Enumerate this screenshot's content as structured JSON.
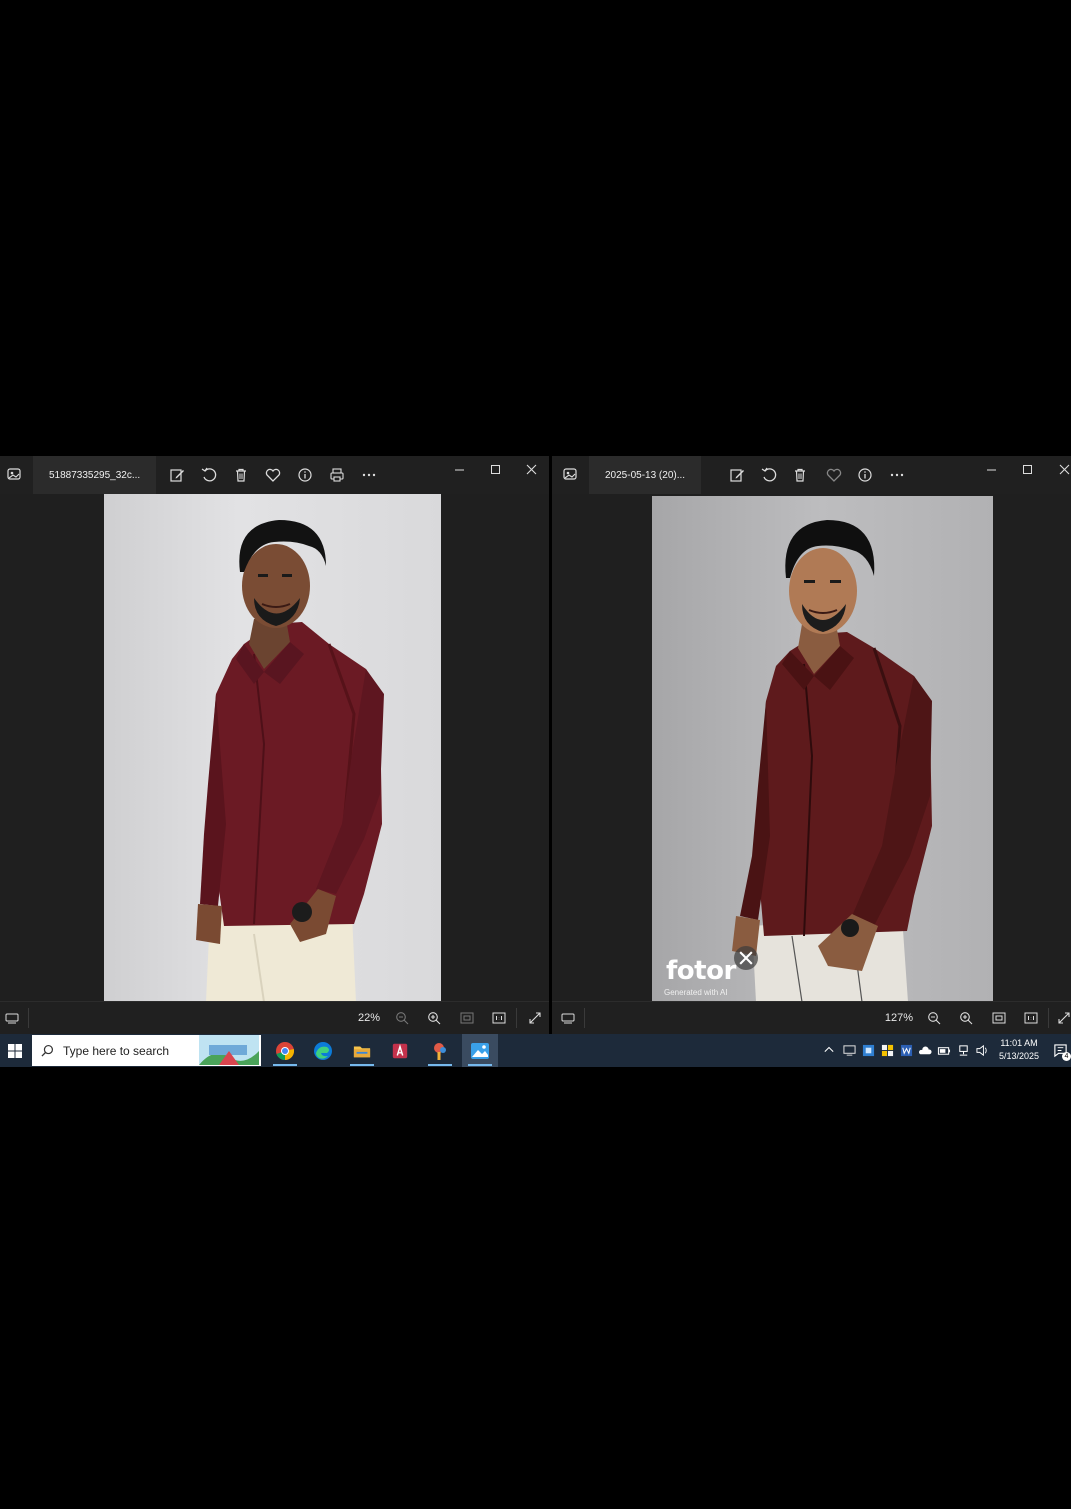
{
  "left_window": {
    "title": "51887335295_32c...",
    "zoom": "22%",
    "toolbar": [
      "edit-icon",
      "rotate-icon",
      "delete-icon",
      "favorite-icon",
      "info-icon",
      "print-icon",
      "more-icon"
    ]
  },
  "right_window": {
    "title": "2025-05-13 (20)...",
    "zoom": "127%",
    "watermark_brand": "fotor",
    "watermark_caption": "Generated with AI",
    "toolbar": [
      "edit-icon",
      "rotate-icon",
      "delete-icon",
      "favorite-icon",
      "info-icon",
      "more-icon"
    ]
  },
  "taskbar": {
    "search_placeholder": "Type here to search",
    "time": "11:01 AM",
    "date": "5/13/2025",
    "notification_count": "4",
    "apps": [
      "chrome-icon",
      "edge-icon",
      "file-explorer-icon",
      "access-icon",
      "paint-icon",
      "photos-icon"
    ]
  },
  "colors": {
    "window_bg": "#1f1f1f",
    "taskbar_bg": "#1d2a3a",
    "shirt_maroon": "#6b1a24",
    "accent": "#76b9ed"
  }
}
